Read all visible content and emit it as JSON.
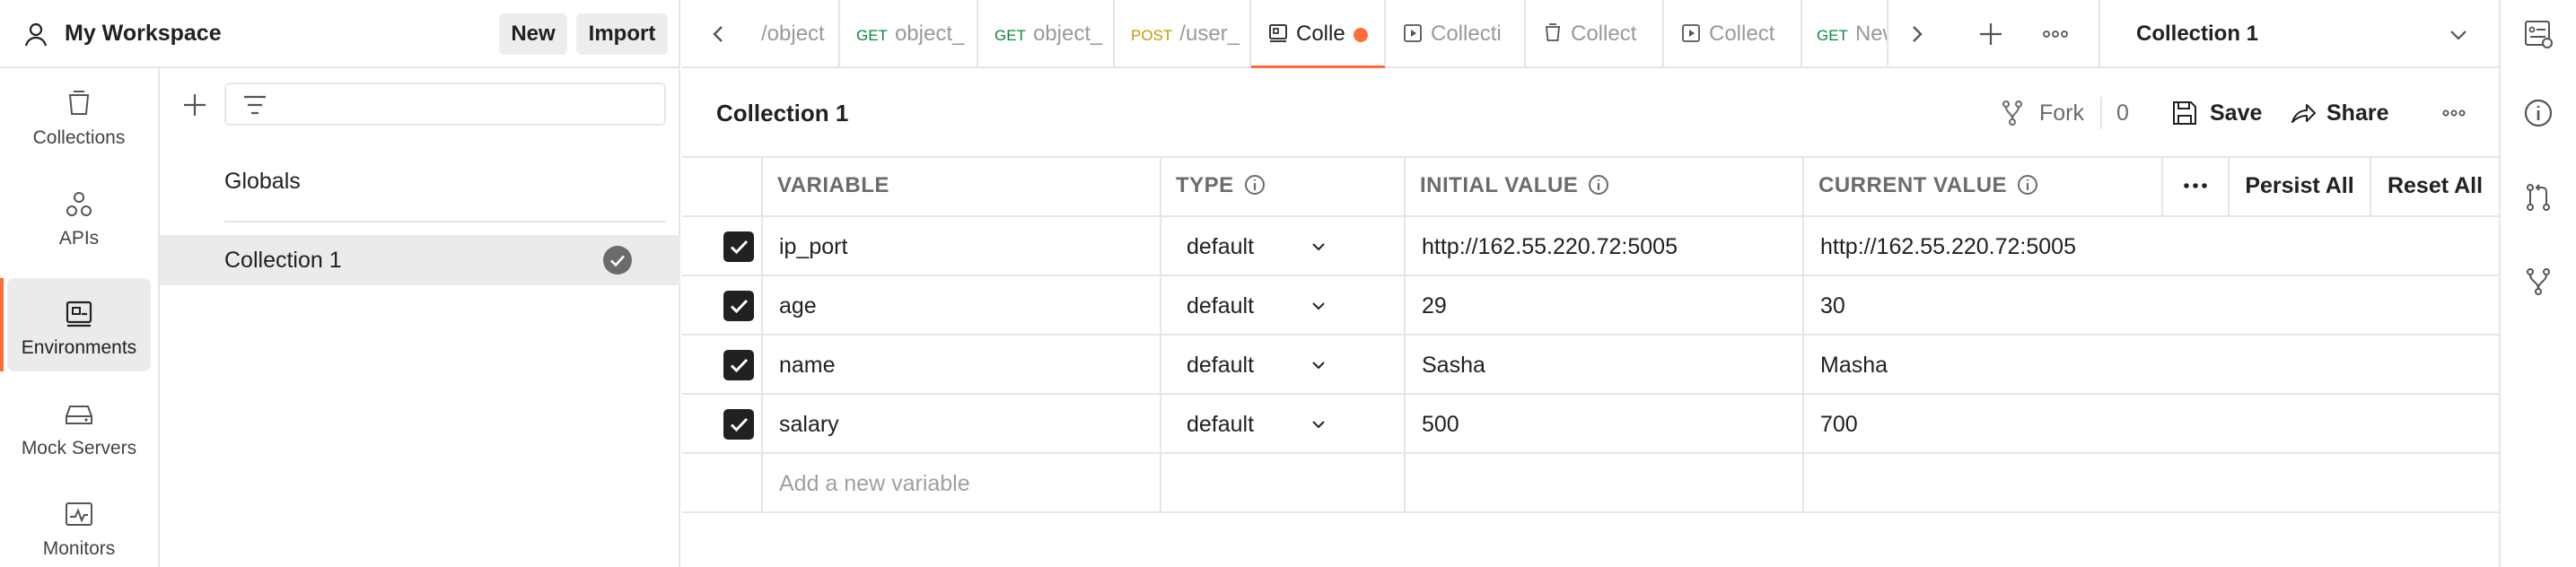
{
  "workspace": {
    "title": "My Workspace",
    "new_label": "New",
    "import_label": "Import"
  },
  "nav": [
    {
      "label": "Collections",
      "icon": "collections-icon"
    },
    {
      "label": "APIs",
      "icon": "apis-icon"
    },
    {
      "label": "Environments",
      "icon": "environments-icon",
      "active": true
    },
    {
      "label": "Mock Servers",
      "icon": "mock-servers-icon"
    },
    {
      "label": "Monitors",
      "icon": "monitors-icon"
    }
  ],
  "env_list": {
    "globals": "Globals",
    "items": [
      {
        "name": "Collection 1",
        "active": true
      }
    ]
  },
  "tabs": [
    {
      "method": "",
      "title": "/object"
    },
    {
      "method": "GET",
      "title": "object_"
    },
    {
      "method": "GET",
      "title": "object_"
    },
    {
      "method": "POST",
      "title": "/user_"
    },
    {
      "method": "",
      "title": "Colle",
      "icon": "environment-icon",
      "active": true,
      "unsaved": true
    },
    {
      "method": "",
      "title": "Collecti",
      "icon": "runner-icon"
    },
    {
      "method": "",
      "title": "Collect",
      "icon": "collection-icon"
    },
    {
      "method": "",
      "title": "Collect",
      "icon": "runner-icon"
    },
    {
      "method": "GET",
      "title": "New"
    }
  ],
  "env_selector": {
    "value": "Collection 1"
  },
  "main": {
    "title": "Collection 1",
    "fork_label": "Fork",
    "fork_count": "0",
    "save_label": "Save",
    "share_label": "Share"
  },
  "table": {
    "headers": {
      "variable": "VARIABLE",
      "type": "TYPE",
      "initial": "INITIAL VALUE",
      "current": "CURRENT VALUE"
    },
    "persist_all": "Persist All",
    "reset_all": "Reset All",
    "rows": [
      {
        "checked": true,
        "variable": "ip_port",
        "type": "default",
        "initial": "http://162.55.220.72:5005",
        "current": "http://162.55.220.72:5005"
      },
      {
        "checked": true,
        "variable": "age",
        "type": "default",
        "initial": "29",
        "current": "30"
      },
      {
        "checked": true,
        "variable": "name",
        "type": "default",
        "initial": "Sasha",
        "current": "Masha"
      },
      {
        "checked": true,
        "variable": "salary",
        "type": "default",
        "initial": "500",
        "current": "700"
      }
    ],
    "add_placeholder": "Add a new variable"
  },
  "colors": {
    "accent": "#ff6c37",
    "get": "#0a8a3a",
    "post": "#c99500"
  }
}
